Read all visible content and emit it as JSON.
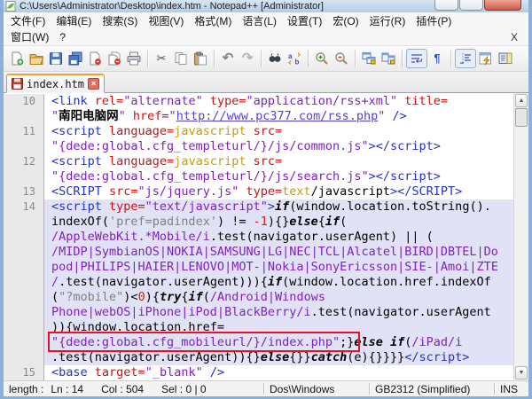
{
  "window": {
    "title": "C:\\Users\\Administrator\\Desktop\\index.htm - Notepad++ [Administrator]"
  },
  "menu": {
    "row1": [
      {
        "name": "file",
        "label": "文件(F)"
      },
      {
        "name": "edit",
        "label": "编辑(E)"
      },
      {
        "name": "search",
        "label": "搜索(S)"
      },
      {
        "name": "view",
        "label": "视图(V)"
      },
      {
        "name": "format",
        "label": "格式(M)"
      },
      {
        "name": "language",
        "label": "语言(L)"
      },
      {
        "name": "settings",
        "label": "设置(T)"
      },
      {
        "name": "macro",
        "label": "宏(O)"
      },
      {
        "name": "run",
        "label": "运行(R)"
      },
      {
        "name": "plugins",
        "label": "插件(P)"
      }
    ],
    "row2": [
      {
        "name": "window",
        "label": "窗口(W)"
      },
      {
        "name": "help",
        "label": "?"
      }
    ],
    "close_label": "X"
  },
  "toolbar": {
    "groups": [
      [
        {
          "name": "new-file-icon"
        },
        {
          "name": "open-file-icon"
        },
        {
          "name": "save-icon"
        },
        {
          "name": "save-all-icon"
        },
        {
          "name": "close-file-icon"
        },
        {
          "name": "close-all-icon"
        },
        {
          "name": "print-icon"
        }
      ],
      [
        {
          "name": "cut-icon"
        },
        {
          "name": "copy-icon"
        },
        {
          "name": "paste-icon"
        }
      ],
      [
        {
          "name": "undo-icon"
        },
        {
          "name": "redo-icon"
        }
      ],
      [
        {
          "name": "find-icon"
        },
        {
          "name": "replace-icon"
        }
      ],
      [
        {
          "name": "zoom-in-icon"
        },
        {
          "name": "zoom-out-icon"
        }
      ],
      [
        {
          "name": "sync-vertical-icon"
        },
        {
          "name": "sync-horizontal-icon"
        }
      ],
      [
        {
          "name": "word-wrap-icon",
          "pressed": true
        },
        {
          "name": "show-all-characters-icon"
        }
      ],
      [
        {
          "name": "indent-guide-icon",
          "pressed": true
        },
        {
          "name": "function-list-icon"
        },
        {
          "name": "document-map-icon"
        }
      ]
    ]
  },
  "tab": {
    "label": "index.htm",
    "modified": true,
    "close_glyph": "×"
  },
  "icons": {
    "scroll_up": "▲",
    "scroll_down": "▼"
  },
  "colors": {
    "accent_tab": "#f0a030",
    "caret_line": "#e2e2f6",
    "annotation": "#e81123"
  },
  "editor": {
    "annotation_display_row": 17,
    "rows": [
      {
        "ln": "10",
        "hl": false,
        "seg": [
          [
            "<link ",
            "tag"
          ],
          [
            "rel=",
            "attr"
          ],
          [
            "\"alternate\" ",
            "str"
          ],
          [
            "type=",
            "attr"
          ],
          [
            "\"application/rss+xml\" ",
            "str"
          ],
          [
            "title=",
            "attr"
          ]
        ]
      },
      {
        "ln": "",
        "hl": false,
        "seg": [
          [
            "\"",
            "str"
          ],
          [
            "南阳电脑网",
            "cjk"
          ],
          [
            "\" ",
            "str"
          ],
          [
            "href=",
            "attr"
          ],
          [
            "\"",
            "str"
          ],
          [
            "http://www.pc377.com/rss.php",
            "url"
          ],
          [
            "\" ",
            "str"
          ],
          [
            "/>",
            "tag"
          ]
        ]
      },
      {
        "ln": "11",
        "hl": false,
        "seg": [
          [
            "<script ",
            "tag"
          ],
          [
            "language=",
            "attr"
          ],
          [
            "javascript ",
            "val"
          ],
          [
            "src=",
            "attr"
          ]
        ]
      },
      {
        "ln": "",
        "hl": false,
        "seg": [
          [
            "\"{dede:global.cfg_templeturl/}/js/common.js\"",
            "str"
          ],
          [
            "></script>",
            "tag"
          ]
        ]
      },
      {
        "ln": "12",
        "hl": false,
        "seg": [
          [
            "<script ",
            "tag"
          ],
          [
            "language=",
            "attr"
          ],
          [
            "javascript ",
            "val"
          ],
          [
            "src=",
            "attr"
          ]
        ]
      },
      {
        "ln": "",
        "hl": false,
        "seg": [
          [
            "\"{dede:global.cfg_templeturl/}/js/search.js\"",
            "str"
          ],
          [
            "></script>",
            "tag"
          ]
        ]
      },
      {
        "ln": "13",
        "hl": false,
        "seg": [
          [
            "<SCRIPT ",
            "tag"
          ],
          [
            "src=",
            "attr"
          ],
          [
            "\"js/jquery.js\" ",
            "str"
          ],
          [
            "type=",
            "attr"
          ],
          [
            "text",
            "val"
          ],
          [
            "/javascript",
            "def"
          ],
          [
            "></SCRIPT>",
            "tag"
          ]
        ]
      },
      {
        "ln": "14",
        "hl": true,
        "seg": [
          [
            "<script ",
            "tag"
          ],
          [
            "type=",
            "attr"
          ],
          [
            "\"text/javascript\"",
            "str"
          ],
          [
            ">",
            "tag"
          ],
          [
            "if",
            "kw"
          ],
          [
            "(window.location.toString().",
            "def"
          ]
        ]
      },
      {
        "ln": "",
        "hl": true,
        "seg": [
          [
            "indexOf(",
            "def"
          ],
          [
            "'pref=padindex'",
            "gs"
          ],
          [
            ") != ",
            "def"
          ],
          [
            "-1",
            "num"
          ],
          [
            "){}",
            "def"
          ],
          [
            "else",
            "kw"
          ],
          [
            "{",
            "def"
          ],
          [
            "if",
            "kw"
          ],
          [
            "(",
            "def"
          ]
        ]
      },
      {
        "ln": "",
        "hl": true,
        "seg": [
          [
            "/AppleWebKit.*Mobile/i",
            "str"
          ],
          [
            ".test(navigator.userAgent) || (",
            "def"
          ]
        ]
      },
      {
        "ln": "",
        "hl": true,
        "seg": [
          [
            "/MIDP|SymbianOS|NOKIA|SAMSUNG|LG|NEC|TCL|Alcatel|BIRD|DBTEL|Do",
            "str"
          ]
        ]
      },
      {
        "ln": "",
        "hl": true,
        "seg": [
          [
            "pod|PHILIPS|HAIER|LENOVO|MOT-|Nokia|SonyEricsson|SIE-|Amoi|ZTE",
            "str"
          ]
        ]
      },
      {
        "ln": "",
        "hl": true,
        "seg": [
          [
            "/",
            "str"
          ],
          [
            ".test(navigator.userAgent))){",
            "def"
          ],
          [
            "if",
            "kw"
          ],
          [
            "(window.location.href.indexOf",
            "def"
          ]
        ]
      },
      {
        "ln": "",
        "hl": true,
        "seg": [
          [
            "(",
            "def"
          ],
          [
            "\"?mobile\"",
            "gs"
          ],
          [
            ")<",
            "def"
          ],
          [
            "0",
            "num"
          ],
          [
            "){",
            "def"
          ],
          [
            "try",
            "kw"
          ],
          [
            "{",
            "def"
          ],
          [
            "if",
            "kw"
          ],
          [
            "(",
            "def"
          ],
          [
            "/Android|Windows",
            "str"
          ]
        ]
      },
      {
        "ln": "",
        "hl": true,
        "seg": [
          [
            "Phone|webOS|iPhone|iPod|BlackBerry/i",
            "str"
          ],
          [
            ".test(navigator.userAgent",
            "def"
          ]
        ]
      },
      {
        "ln": "",
        "hl": true,
        "seg": [
          [
            ")){window.location.href=",
            "def"
          ]
        ]
      },
      {
        "ln": "",
        "hl": true,
        "seg": [
          [
            "\"{dede:global.cfg_mobileurl/}/index.php\"",
            "str"
          ],
          [
            ";}",
            "def"
          ],
          [
            "else if",
            "kw"
          ],
          [
            "(",
            "def"
          ],
          [
            "/iPad/i",
            "str"
          ]
        ]
      },
      {
        "ln": "",
        "hl": true,
        "seg": [
          [
            ".test(navigator.userAgent)){}",
            "def"
          ],
          [
            "else",
            "kw"
          ],
          [
            "{}}",
            "def"
          ],
          [
            "catch",
            "kw"
          ],
          [
            "(e){}}}}",
            "def"
          ],
          [
            "</script>",
            "tag"
          ]
        ]
      },
      {
        "ln": "15",
        "hl": false,
        "seg": [
          [
            "<base ",
            "tag"
          ],
          [
            "target=",
            "attr"
          ],
          [
            "\"_blank\" ",
            "str"
          ],
          [
            "/>",
            "tag"
          ]
        ]
      }
    ]
  },
  "statusbar": {
    "length_label": "length :",
    "line": "Ln : 14",
    "col": "Col : 504",
    "sel": "Sel : 0 | 0",
    "eol": "Dos\\Windows",
    "encoding": "GB2312 (Simplified)",
    "insert_mode": "INS"
  }
}
